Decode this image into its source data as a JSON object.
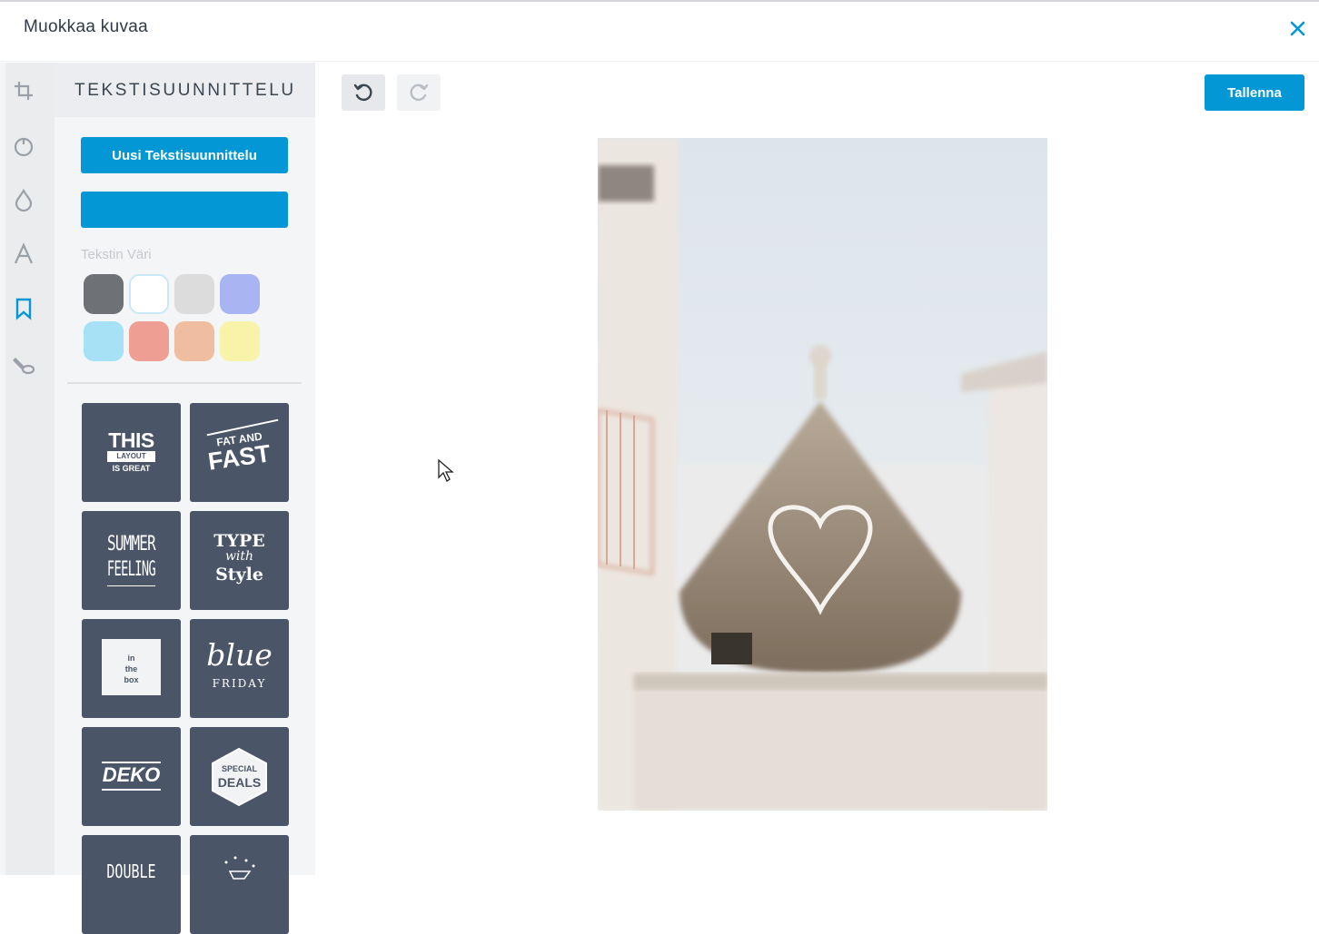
{
  "window": {
    "title": "Muokkaa kuvaa"
  },
  "toolrail": {
    "tools": [
      "crop-icon",
      "adjust-icon",
      "drop-icon",
      "text-icon",
      "bookmark-icon",
      "brush-icon"
    ]
  },
  "panel": {
    "title": "TEKSTISUUNNITTELU",
    "new_design_label": "Uusi Tekstisuunnittelu",
    "second_button_label": "",
    "text_color_label": "Tekstin Väri",
    "colors": [
      "#6e7277",
      "#ffffff",
      "#dcdcdc",
      "#a9b4f2",
      "#a6e1f6",
      "#ee9e93",
      "#efbd9f",
      "#f9f3a9"
    ],
    "templates": [
      {
        "name": "this-layout-is-great",
        "lines": [
          "THIS",
          "LAYOUT",
          "IS GREAT"
        ]
      },
      {
        "name": "fat-and-fast",
        "lines": [
          "FAT AND",
          "FAST"
        ]
      },
      {
        "name": "summer-feeling",
        "lines": [
          "SUMMER",
          "FEELING"
        ]
      },
      {
        "name": "type-with-style",
        "lines": [
          "TYPE",
          "with",
          "Style"
        ]
      },
      {
        "name": "in-the-box",
        "lines": [
          "in",
          "the",
          "box"
        ]
      },
      {
        "name": "blue-friday",
        "lines": [
          "blue",
          "FRIDAY"
        ]
      },
      {
        "name": "deko",
        "lines": [
          "DEKO"
        ]
      },
      {
        "name": "special-deals",
        "lines": [
          "SPECIAL",
          "DEALS"
        ]
      },
      {
        "name": "double",
        "lines": [
          "DOUBLE"
        ]
      },
      {
        "name": "celebration",
        "lines": []
      }
    ]
  },
  "toolbar": {
    "undo_icon": "undo-icon",
    "redo_icon": "redo-icon",
    "save_label": "Tallenna"
  },
  "accent": "#0398d5"
}
